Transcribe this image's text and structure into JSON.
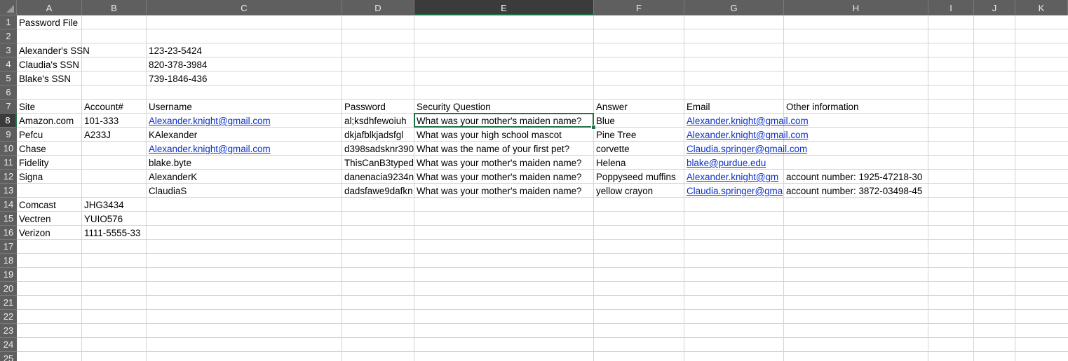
{
  "columns": [
    "A",
    "B",
    "C",
    "D",
    "E",
    "F",
    "G",
    "H",
    "I",
    "J",
    "K"
  ],
  "selected_column": "E",
  "selected_row": 8,
  "row_numbers": [
    "1",
    "2",
    "3",
    "4",
    "5",
    "6",
    "7",
    "8",
    "9",
    "10",
    "11",
    "12",
    "13",
    "14",
    "15",
    "16",
    "17",
    "18",
    "19",
    "20",
    "21",
    "22",
    "23",
    "24",
    "25"
  ],
  "rows": [
    {
      "r": 1,
      "cells": [
        {
          "c": "A",
          "v": "Password File"
        }
      ]
    },
    {
      "r": 3,
      "cells": [
        {
          "c": "A",
          "v": "Alexander's SSN"
        },
        {
          "c": "C",
          "v": "123-23-5424"
        }
      ]
    },
    {
      "r": 4,
      "cells": [
        {
          "c": "A",
          "v": "Claudia's SSN"
        },
        {
          "c": "C",
          "v": "820-378-3984"
        }
      ]
    },
    {
      "r": 5,
      "cells": [
        {
          "c": "A",
          "v": "Blake's SSN"
        },
        {
          "c": "C",
          "v": "739-1846-436"
        }
      ]
    },
    {
      "r": 7,
      "cells": [
        {
          "c": "A",
          "v": "Site"
        },
        {
          "c": "B",
          "v": "Account#"
        },
        {
          "c": "C",
          "v": "Username"
        },
        {
          "c": "D",
          "v": "Password"
        },
        {
          "c": "E",
          "v": "Security Question"
        },
        {
          "c": "F",
          "v": "Answer"
        },
        {
          "c": "G",
          "v": "Email"
        },
        {
          "c": "H",
          "v": "Other information"
        }
      ]
    },
    {
      "r": 8,
      "cells": [
        {
          "c": "A",
          "v": "Amazon.com"
        },
        {
          "c": "B",
          "v": "101-333"
        },
        {
          "c": "C",
          "v": "Alexander.knight@gmail.com",
          "link": true
        },
        {
          "c": "D",
          "v": "al;ksdhfewoiuh"
        },
        {
          "c": "E",
          "v": "What was your mother's maiden name?"
        },
        {
          "c": "F",
          "v": "Blue"
        },
        {
          "c": "G",
          "v": "Alexander.knight@gmail.com",
          "link": true
        }
      ]
    },
    {
      "r": 9,
      "cells": [
        {
          "c": "A",
          "v": "Pefcu"
        },
        {
          "c": "B",
          "v": "A233J"
        },
        {
          "c": "C",
          "v": "KAlexander"
        },
        {
          "c": "D",
          "v": "dkjafblkjadsfgl"
        },
        {
          "c": "E",
          "v": "What was your high school mascot"
        },
        {
          "c": "F",
          "v": "Pine Tree"
        },
        {
          "c": "G",
          "v": "Alexander.knight@gmail.com",
          "link": true
        }
      ]
    },
    {
      "r": 10,
      "cells": [
        {
          "c": "A",
          "v": "Chase"
        },
        {
          "c": "C",
          "v": "Alexander.knight@gmail.com",
          "link": true
        },
        {
          "c": "D",
          "v": "d398sadsknr390"
        },
        {
          "c": "E",
          "v": "What was the name of your first pet?"
        },
        {
          "c": "F",
          "v": "corvette"
        },
        {
          "c": "G",
          "v": "Claudia.springer@gmail.com",
          "link": true
        }
      ]
    },
    {
      "r": 11,
      "cells": [
        {
          "c": "A",
          "v": "Fidelity"
        },
        {
          "c": "C",
          "v": "blake.byte"
        },
        {
          "c": "D",
          "v": "ThisCanB3typed"
        },
        {
          "c": "E",
          "v": "What was your mother's maiden name?"
        },
        {
          "c": "F",
          "v": "Helena"
        },
        {
          "c": "G",
          "v": "blake@purdue.edu",
          "link": true
        }
      ]
    },
    {
      "r": 12,
      "cells": [
        {
          "c": "A",
          "v": "Signa"
        },
        {
          "c": "C",
          "v": "AlexanderK"
        },
        {
          "c": "D",
          "v": "danenacia9234n"
        },
        {
          "c": "E",
          "v": "What was your mother's maiden name?"
        },
        {
          "c": "F",
          "v": "Poppyseed muffins"
        },
        {
          "c": "G",
          "v": "Alexander.knight@gm",
          "link": true
        },
        {
          "c": "H",
          "v": "account number: 1925-47218-30"
        }
      ]
    },
    {
      "r": 13,
      "cells": [
        {
          "c": "C",
          "v": "ClaudiaS"
        },
        {
          "c": "D",
          "v": "dadsfawe9dafkn"
        },
        {
          "c": "E",
          "v": "What was your mother's maiden name?"
        },
        {
          "c": "F",
          "v": "yellow crayon"
        },
        {
          "c": "G",
          "v": "Claudia.springer@gma",
          "link": true
        },
        {
          "c": "H",
          "v": "account number: 3872-03498-45"
        }
      ]
    },
    {
      "r": 14,
      "cells": [
        {
          "c": "A",
          "v": "Comcast"
        },
        {
          "c": "B",
          "v": "JHG3434"
        }
      ]
    },
    {
      "r": 15,
      "cells": [
        {
          "c": "A",
          "v": "Vectren"
        },
        {
          "c": "B",
          "v": "YUIO576"
        }
      ]
    },
    {
      "r": 16,
      "cells": [
        {
          "c": "A",
          "v": "Verizon"
        },
        {
          "c": "B",
          "v": "1111-5555-33"
        }
      ]
    }
  ]
}
